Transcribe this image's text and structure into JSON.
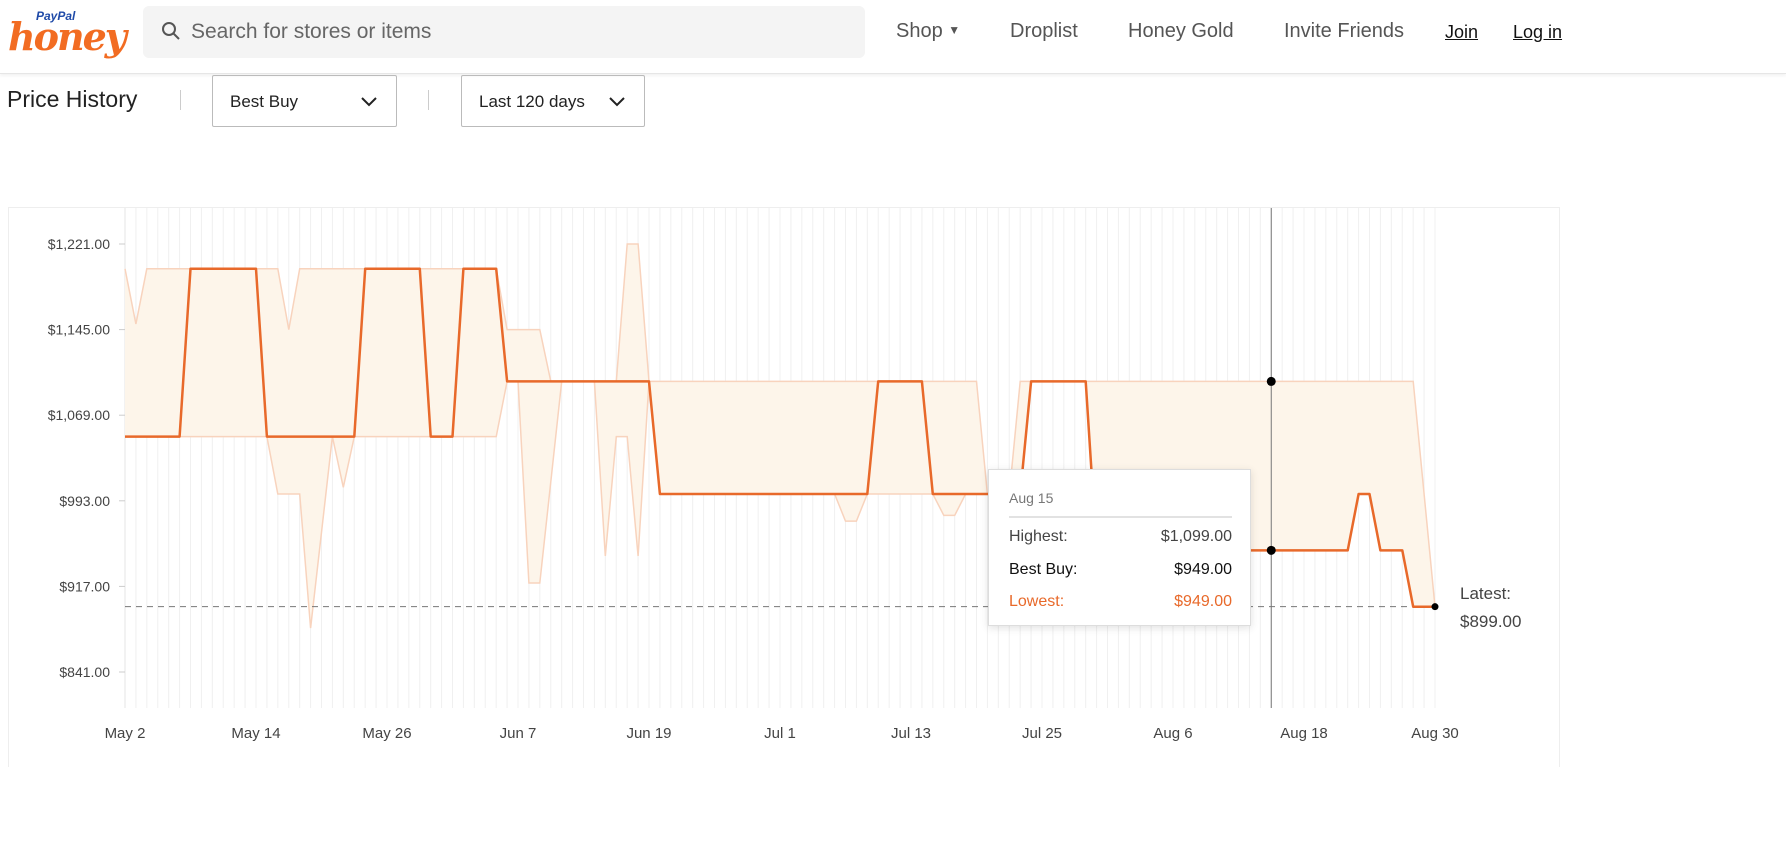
{
  "logo": {
    "paypal": "PayPal",
    "honey": "honey"
  },
  "search": {
    "placeholder": "Search for stores or items",
    "icon": "search-icon"
  },
  "nav": {
    "shop": "Shop",
    "droplist": "Droplist",
    "honey_gold": "Honey Gold",
    "invite": "Invite Friends",
    "join": "Join",
    "login": "Log in"
  },
  "toolbar": {
    "title": "Price History",
    "store": "Best Buy",
    "range": "Last 120 days"
  },
  "colors": {
    "accent": "#e8692a",
    "band_fill": "#fdf5ea",
    "band_stroke": "#f8d3bd"
  },
  "tooltip": {
    "date": "Aug 15",
    "highest_label": "Highest:",
    "highest_value": "$1,099.00",
    "store_label": "Best Buy:",
    "store_value": "$949.00",
    "lowest_label": "Lowest:",
    "lowest_value": "$949.00"
  },
  "latest": {
    "label": "Latest:",
    "value": "$899.00"
  },
  "chart_data": {
    "type": "line",
    "ylim": [
      841,
      1221
    ],
    "yticks": [
      1221,
      1145,
      1069,
      993,
      917,
      841
    ],
    "ytick_labels": [
      "$1,221.00",
      "$1,145.00",
      "$1,069.00",
      "$993.00",
      "$917.00",
      "$841.00"
    ],
    "xlim": [
      "May 2",
      "Aug 30"
    ],
    "xtick_labels": [
      "May 2",
      "May 14",
      "May 26",
      "Jun 7",
      "Jun 19",
      "Jul 1",
      "Jul 13",
      "Jul 25",
      "Aug 6",
      "Aug 18",
      "Aug 30"
    ],
    "grid": "vertical daily",
    "reference_line": 899,
    "hover_date": "Aug 15",
    "series": [
      {
        "name": "Highest",
        "style": "band-top",
        "points": [
          [
            "May 2",
            1199
          ],
          [
            "May 3",
            1150
          ],
          [
            "May 4",
            1199
          ],
          [
            "May 16",
            1199
          ],
          [
            "May 17",
            1145
          ],
          [
            "May 18",
            1199
          ],
          [
            "Jun 5",
            1199
          ],
          [
            "Jun 6",
            1145
          ],
          [
            "Jun 9",
            1145
          ],
          [
            "Jun 10",
            1099
          ],
          [
            "Jun 16",
            1099
          ],
          [
            "Jun 17",
            1221
          ],
          [
            "Jun 18",
            1221
          ],
          [
            "Jun 19",
            1099
          ],
          [
            "Jul 19",
            1099
          ],
          [
            "Jul 20",
            999
          ],
          [
            "Jul 22",
            999
          ],
          [
            "Jul 23",
            1099
          ],
          [
            "Aug 28",
            1099
          ],
          [
            "Aug 30",
            899
          ]
        ]
      },
      {
        "name": "Lowest",
        "style": "band-bottom",
        "points": [
          [
            "May 2",
            1049.99
          ],
          [
            "May 15",
            1049.99
          ],
          [
            "May 16",
            999
          ],
          [
            "May 18",
            999
          ],
          [
            "May 19",
            880
          ],
          [
            "May 21",
            1049.99
          ],
          [
            "May 22",
            1005
          ],
          [
            "May 23",
            1049.99
          ],
          [
            "Jun 5",
            1049.99
          ],
          [
            "Jun 6",
            1099
          ],
          [
            "Jun 7",
            1099
          ],
          [
            "Jun 8",
            920
          ],
          [
            "Jun 9",
            920
          ],
          [
            "Jun 11",
            1099
          ],
          [
            "Jun 14",
            1099
          ],
          [
            "Jun 15",
            944
          ],
          [
            "Jun 16",
            1049.99
          ],
          [
            "Jun 17",
            1049.99
          ],
          [
            "Jun 18",
            944
          ],
          [
            "Jun 19",
            1099
          ],
          [
            "Jun 20",
            999
          ],
          [
            "Jul 6",
            999
          ],
          [
            "Jul 7",
            975
          ],
          [
            "Jul 8",
            975
          ],
          [
            "Jul 9",
            999
          ],
          [
            "Jul 15",
            999
          ],
          [
            "Jul 16",
            980
          ],
          [
            "Jul 17",
            980
          ],
          [
            "Jul 18",
            999
          ],
          [
            "Jul 23",
            999
          ],
          [
            "Jul 24",
            1099
          ],
          [
            "Jul 29",
            1099
          ],
          [
            "Jul 30",
            949
          ],
          [
            "Aug 22",
            949
          ],
          [
            "Aug 23",
            999
          ],
          [
            "Aug 24",
            999
          ],
          [
            "Aug 25",
            949
          ],
          [
            "Aug 27",
            949
          ],
          [
            "Aug 28",
            899
          ],
          [
            "Aug 30",
            899
          ]
        ]
      },
      {
        "name": "Best Buy",
        "style": "line",
        "points": [
          [
            "May 2",
            1049.99
          ],
          [
            "May 7",
            1049.99
          ],
          [
            "May 8",
            1199
          ],
          [
            "May 14",
            1199
          ],
          [
            "May 15",
            1049.99
          ],
          [
            "May 23",
            1049.99
          ],
          [
            "May 24",
            1199
          ],
          [
            "May 29",
            1199
          ],
          [
            "May 30",
            1049.99
          ],
          [
            "Jun 1",
            1049.99
          ],
          [
            "Jun 2",
            1199
          ],
          [
            "Jun 5",
            1199
          ],
          [
            "Jun 6",
            1099
          ],
          [
            "Jun 19",
            1099
          ],
          [
            "Jun 20",
            999
          ],
          [
            "Jul 9",
            999
          ],
          [
            "Jul 10",
            1099
          ],
          [
            "Jul 14",
            1099
          ],
          [
            "Jul 15",
            999
          ],
          [
            "Jul 23",
            999
          ],
          [
            "Jul 24",
            1099
          ],
          [
            "Jul 29",
            1099
          ],
          [
            "Jul 30",
            949
          ],
          [
            "Aug 22",
            949
          ],
          [
            "Aug 23",
            999
          ],
          [
            "Aug 24",
            999
          ],
          [
            "Aug 25",
            949
          ],
          [
            "Aug 27",
            949
          ],
          [
            "Aug 28",
            899
          ],
          [
            "Aug 30",
            899
          ]
        ]
      }
    ]
  }
}
